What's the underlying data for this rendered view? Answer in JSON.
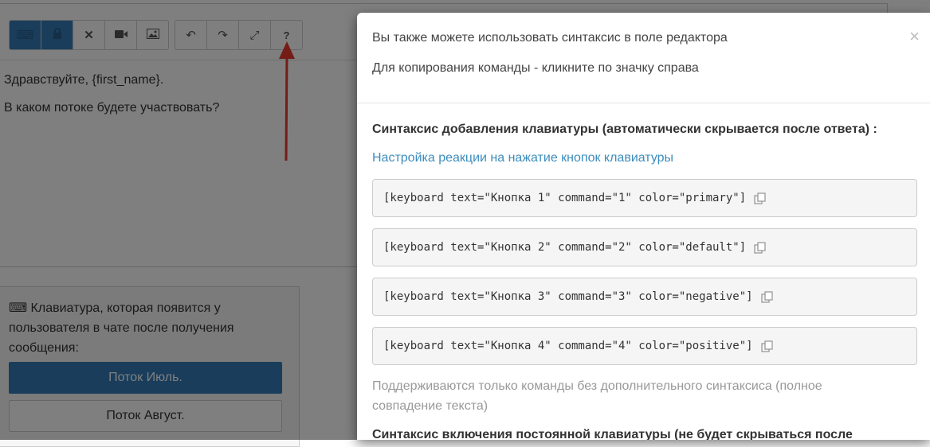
{
  "editor": {
    "text_lines": [
      "Здравствуйте, {first_name}.",
      "В каком потоке будете участвовать?"
    ],
    "toolbar_icons": [
      "keyboard-icon",
      "lock-icon",
      "close-icon",
      "video-icon",
      "image-icon",
      "undo-icon",
      "redo-icon",
      "fullscreen-icon",
      "help-icon"
    ],
    "help_symbol": "?"
  },
  "keyboard_panel": {
    "description": "⌨ Клавиатура, которая появится у пользователя в чате после получения сообщения:",
    "buttons": [
      {
        "label": "Поток Июль.",
        "style": "primary"
      },
      {
        "label": "Поток Август.",
        "style": "default"
      }
    ]
  },
  "modal": {
    "header_line1": "Вы также можете использовать синтаксис в поле редактора",
    "header_line2": "Для копирования команды - кликните по значку справа",
    "close_symbol": "×",
    "section1_title": "Синтаксис добавления клавиатуры (автоматически скрывается после ответа) :",
    "link_text": "Настройка реакции на нажатие кнопок клавиатуры",
    "code_lines": [
      "[keyboard text=\"Кнопка 1\" command=\"1\" color=\"primary\"]",
      "[keyboard text=\"Кнопка 2\" command=\"2\" color=\"default\"]",
      "[keyboard text=\"Кнопка 3\" command=\"3\" color=\"negative\"]",
      "[keyboard text=\"Кнопка 4\" command=\"4\" color=\"positive\"]"
    ],
    "note": "Поддерживаются только команды без дополнительного синтаксиса (полное совпадение текста)",
    "section2_title": "Синтаксис включения постоянной клавиатуры (не будет скрываться после"
  },
  "colors": {
    "primary": "#337ab7",
    "link": "#3c8dbc",
    "overlay": "rgba(0,0,0,0.5)"
  }
}
